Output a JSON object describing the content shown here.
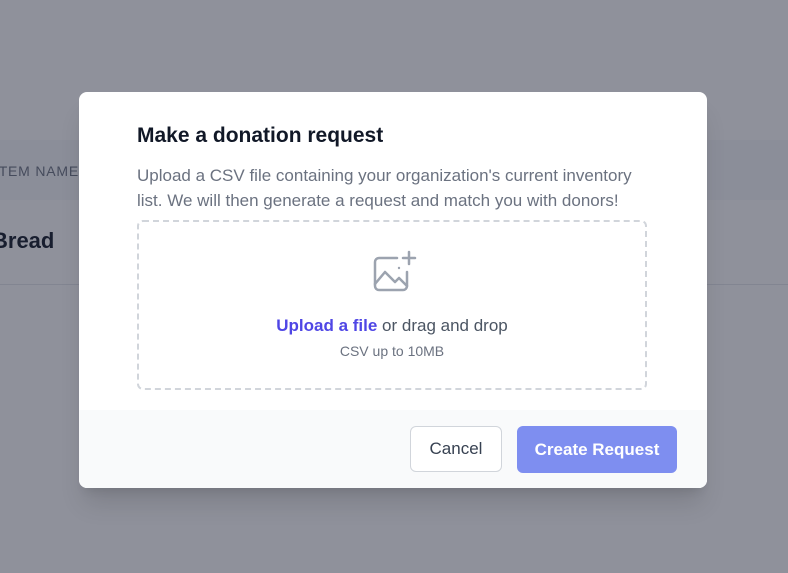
{
  "background": {
    "column_label": "Item Name",
    "row_value": "Bread"
  },
  "modal": {
    "title": "Make a donation request",
    "description": "Upload a CSV file containing your organization's current inventory list. We will then generate a request and match you with donors!",
    "dropzone": {
      "icon": "image-add-icon",
      "upload_link": "Upload a file",
      "drag_text": " or drag and drop",
      "hint": "CSV up to 10MB"
    },
    "footer": {
      "cancel_label": "Cancel",
      "create_label": "Create Request"
    }
  },
  "colors": {
    "overlay": "#1f2438",
    "link": "#4f46e5",
    "primary_button": "#7e8ef0",
    "footer_bg": "#f9fafb"
  }
}
